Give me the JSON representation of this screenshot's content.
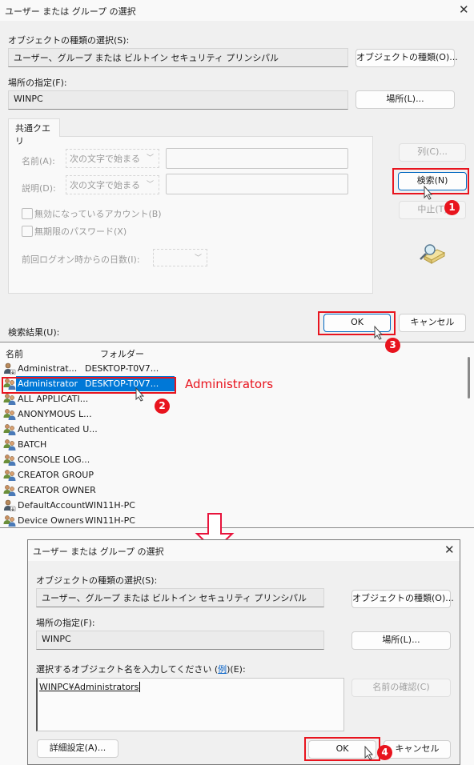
{
  "top_dialog": {
    "title": "ユーザー または グループ の選択",
    "object_type_label": "オブジェクトの種類の選択(S):",
    "object_type_value": "ユーザー、グループ または ビルトイン セキュリティ プリンシパル",
    "object_type_button": "オブジェクトの種類(O)...",
    "location_label": "場所の指定(F):",
    "location_value": "WINPC",
    "location_button": "場所(L)...",
    "tab_label": "共通クエリ",
    "name_label": "名前(A):",
    "name_mode": "次の文字で始まる",
    "desc_label": "説明(D):",
    "desc_mode": "次の文字で始まる",
    "disabled_accounts": "無効になっているアカウント(B)",
    "non_expiring_password": "無期限のパスワード(X)",
    "days_since_logon": "前回ログオン時からの日数(I):",
    "columns_button": "列(C)...",
    "search_button": "検索(N)",
    "stop_button": "中止(T)",
    "ok_button": "OK",
    "cancel_button": "キャンセル",
    "results_label": "検索結果(U):"
  },
  "results": {
    "columns": [
      "名前",
      "フォルダー"
    ],
    "rows": [
      {
        "name": "Administrat...",
        "folder": "DESKTOP-T0V7...",
        "icon": "user-icon",
        "selected": false
      },
      {
        "name": "Administrator",
        "folder": "DESKTOP-T0V7...",
        "icon": "group-icon",
        "selected": true
      },
      {
        "name": "ALL APPLICATI...",
        "folder": "",
        "icon": "group-icon",
        "selected": false
      },
      {
        "name": "ANONYMOUS L...",
        "folder": "",
        "icon": "group-icon",
        "selected": false
      },
      {
        "name": "Authenticated U...",
        "folder": "",
        "icon": "group-icon",
        "selected": false
      },
      {
        "name": "BATCH",
        "folder": "",
        "icon": "group-icon",
        "selected": false
      },
      {
        "name": "CONSOLE LOG...",
        "folder": "",
        "icon": "group-icon",
        "selected": false
      },
      {
        "name": "CREATOR GROUP",
        "folder": "",
        "icon": "group-icon",
        "selected": false
      },
      {
        "name": "CREATOR OWNER",
        "folder": "",
        "icon": "group-icon",
        "selected": false
      },
      {
        "name": "DefaultAccount",
        "folder": "WIN11H-PC",
        "icon": "user-icon",
        "selected": false
      },
      {
        "name": "Device Owners",
        "folder": "WIN11H-PC",
        "icon": "group-icon",
        "selected": false
      }
    ]
  },
  "annotations": {
    "callout_text": "Administrators",
    "callout_color": "#e8141e",
    "steps": [
      "1",
      "2",
      "3",
      "4"
    ]
  },
  "bottom_dialog": {
    "title": "ユーザー または グループ の選択",
    "object_type_label": "オブジェクトの種類の選択(S):",
    "object_type_value": "ユーザー、グループ または ビルトイン セキュリティ プリンシパル",
    "object_type_button": "オブジェクトの種類(O)...",
    "location_label": "場所の指定(F):",
    "location_value": "WINPC",
    "location_button": "場所(L)...",
    "enter_label_pre": "選択するオブジェクト名を入力してください (",
    "enter_label_link": "例",
    "enter_label_post": ")(E):",
    "object_names_value": "WINPC¥Administrators",
    "check_names_button": "名前の確認(C)",
    "advanced_button": "詳細設定(A)...",
    "ok_button": "OK",
    "cancel_button": "キャンセル"
  }
}
